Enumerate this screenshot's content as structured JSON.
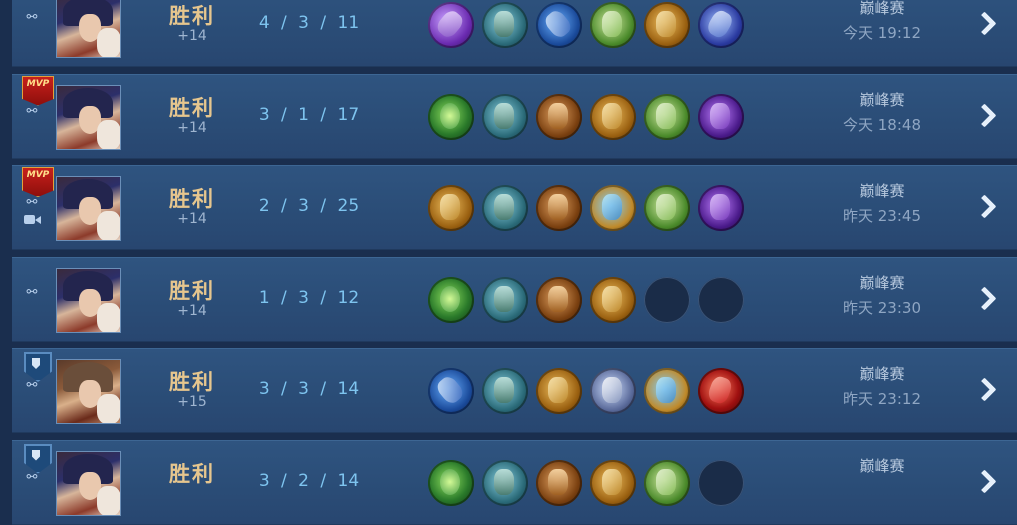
{
  "matches": [
    {
      "mvp": false,
      "mvp_label": "",
      "shield": false,
      "camera": false,
      "hero": "a",
      "result": "胜利",
      "score": "+14",
      "kda": "4 / 3 / 11",
      "items": [
        "it-sword",
        "it-boot",
        "it-spear",
        "it-axe",
        "it-gold",
        "it-blade"
      ],
      "mode": "巅峰赛",
      "time": "今天 19:12"
    },
    {
      "mvp": true,
      "mvp_label": "MVP",
      "shield": false,
      "camera": false,
      "hero": "a",
      "result": "胜利",
      "score": "+14",
      "kda": "3 / 1 / 17",
      "items": [
        "it-greenorb",
        "it-boot",
        "it-armor",
        "it-gold",
        "it-axe",
        "it-purple"
      ],
      "mode": "巅峰赛",
      "time": "今天 18:48"
    },
    {
      "mvp": true,
      "mvp_label": "MVP",
      "shield": false,
      "camera": true,
      "hero": "a",
      "result": "胜利",
      "score": "+14",
      "kda": "2 / 3 / 25",
      "items": [
        "it-gold",
        "it-boot",
        "it-armor",
        "it-wings",
        "it-axe",
        "it-purple"
      ],
      "mode": "巅峰赛",
      "time": "昨天 23:45"
    },
    {
      "mvp": false,
      "mvp_label": "",
      "shield": false,
      "camera": false,
      "hero": "a",
      "result": "胜利",
      "score": "+14",
      "kda": "1 / 3 / 12",
      "items": [
        "it-greenorb",
        "it-boot",
        "it-armor",
        "it-gold",
        "it-empty",
        "it-empty"
      ],
      "mode": "巅峰赛",
      "time": "昨天 23:30"
    },
    {
      "mvp": false,
      "mvp_label": "",
      "shield": true,
      "camera": false,
      "hero": "b",
      "result": "胜利",
      "score": "+15",
      "kda": "3 / 3 / 14",
      "items": [
        "it-spear",
        "it-boot",
        "it-gold",
        "it-helm",
        "it-wings",
        "it-ruby"
      ],
      "mode": "巅峰赛",
      "time": "昨天 23:12"
    },
    {
      "mvp": false,
      "mvp_label": "",
      "shield": true,
      "camera": false,
      "hero": "a",
      "result": "胜利",
      "score": "",
      "kda": "3 / 2 / 14",
      "items": [
        "it-greenorb",
        "it-boot",
        "it-armor",
        "it-gold",
        "it-axe",
        "it-empty"
      ],
      "mode": "巅峰赛",
      "time": ""
    }
  ],
  "icons": {
    "replay": "replay-icon",
    "camera": "video-camera-icon",
    "mvp": "mvp-badge",
    "shield": "shield-icon",
    "detail": "chevron-right-icon"
  },
  "colors": {
    "result": "#e6c68e",
    "kda": "#7ec4ef",
    "row_bg": "#2f5480"
  }
}
